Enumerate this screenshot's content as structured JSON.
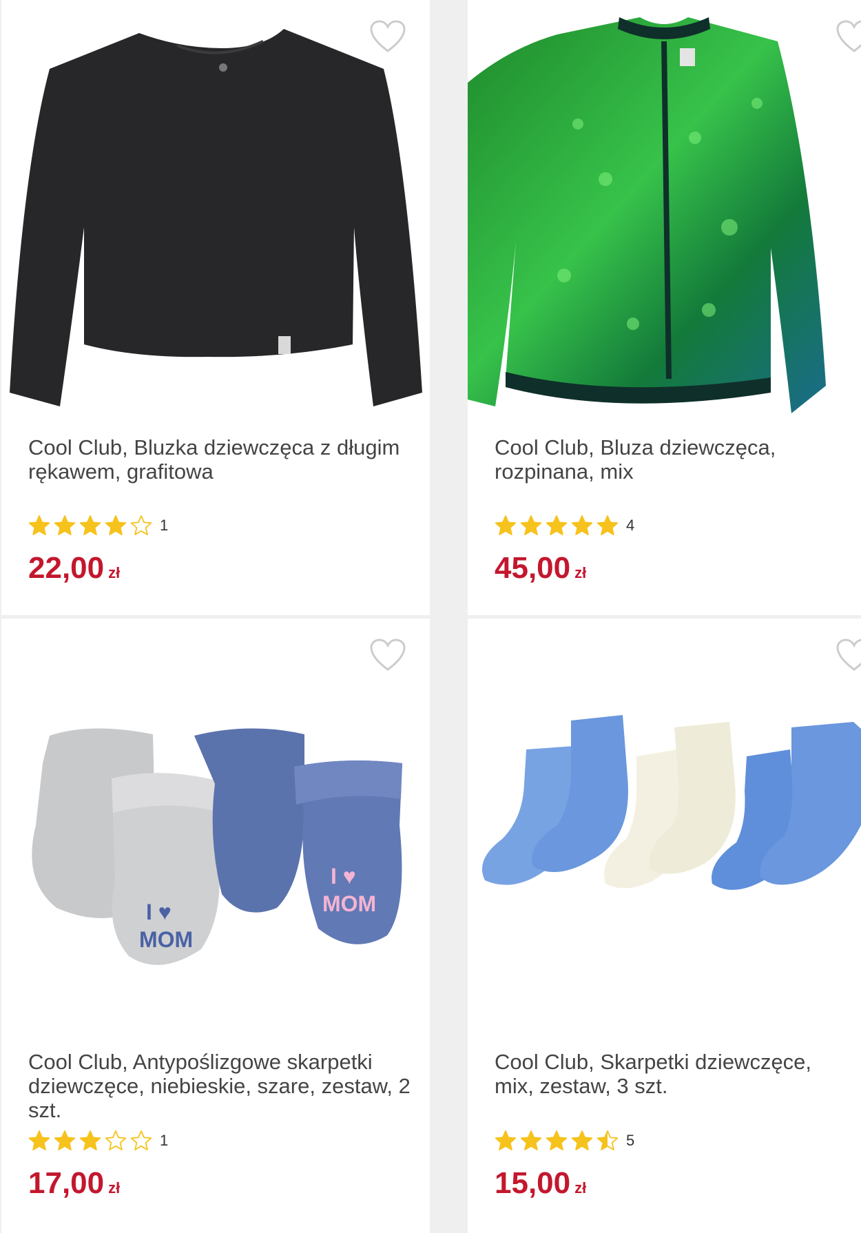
{
  "products": [
    {
      "title": "Cool Club, Bluzka dziewczęca z długim rękawem, grafitowa",
      "rating": 4,
      "rating_count": "1",
      "price": "22,00",
      "currency": "zł",
      "image": "black-long-sleeve-top"
    },
    {
      "title": "Cool Club, Bluza dziewczęca, rozpinana, mix",
      "rating": 5,
      "rating_count": "4",
      "price": "45,00",
      "currency": "zł",
      "image": "green-sequin-bomber-jacket"
    },
    {
      "title": "Cool Club, Antypoślizgowe skarpetki dziewczęce, niebieskie, szare, zestaw, 2 szt.",
      "rating": 3,
      "rating_count": "1",
      "price": "17,00",
      "currency": "zł",
      "image": "i-love-mom-baby-socks"
    },
    {
      "title": "Cool Club, Skarpetki dziewczęce, mix, zestaw, 3 szt.",
      "rating": 4.5,
      "rating_count": "5",
      "price": "15,00",
      "currency": "zł",
      "image": "blue-white-socks-set"
    }
  ],
  "colors": {
    "price": "#c3172e",
    "star": "#f6c21c",
    "heart_outline": "#cccccc"
  },
  "icons": {
    "wishlist": "heart-outline-icon",
    "rating": "star-icon"
  }
}
